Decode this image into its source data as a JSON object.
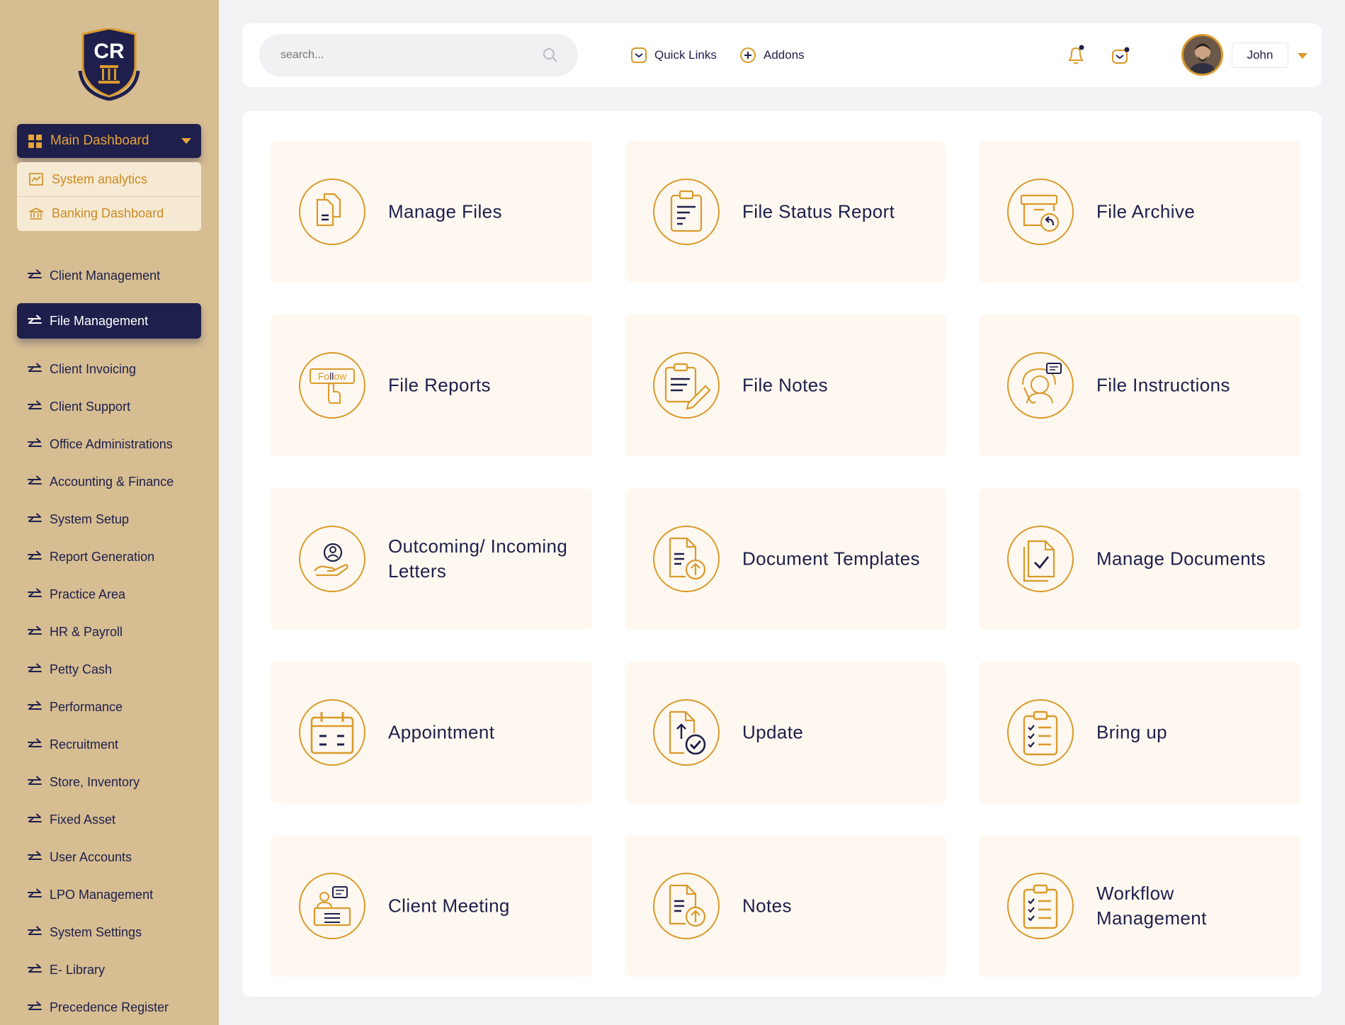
{
  "brand": {
    "logo_text": "CR"
  },
  "sidebar": {
    "dashboard_label": "Main Dashboard",
    "submenu": [
      {
        "label": "System analytics",
        "icon": "chart-icon"
      },
      {
        "label": "Banking Dashboard",
        "icon": "bank-icon"
      }
    ],
    "items": [
      {
        "label": "Client Management"
      },
      {
        "label": "File Management",
        "active": true
      },
      {
        "label": "Client Invoicing"
      },
      {
        "label": " Client Support"
      },
      {
        "label": "Office Administrations"
      },
      {
        "label": "Accounting & Finance"
      },
      {
        "label": "System Setup"
      },
      {
        "label": "Report Generation"
      },
      {
        "label": "Practice Area"
      },
      {
        "label": "HR & Payroll"
      },
      {
        "label": "Petty Cash"
      },
      {
        "label": "Performance"
      },
      {
        "label": "Recruitment"
      },
      {
        "label": "Store, Inventory"
      },
      {
        "label": "Fixed Asset"
      },
      {
        "label": "User Accounts"
      },
      {
        "label": "LPO Management"
      },
      {
        "label": "System Settings"
      },
      {
        "label": "E- Library"
      },
      {
        "label": "Precedence Register"
      }
    ]
  },
  "header": {
    "search_placeholder": "search...",
    "quick_links": "Quick Links",
    "addons": "Addons",
    "user_name": "John"
  },
  "cards": [
    {
      "label": "Manage Files",
      "icon": "files-icon"
    },
    {
      "label": "File Status Report",
      "icon": "clipboard-report-icon"
    },
    {
      "label": "File Archive",
      "icon": "archive-icon"
    },
    {
      "label": "File Reports",
      "icon": "follow-hand-icon",
      "icon_text": "Follow"
    },
    {
      "label": "File Notes",
      "icon": "notes-pencil-icon"
    },
    {
      "label": "File Instructions",
      "icon": "support-agent-icon"
    },
    {
      "label": "Outcoming/ Incoming Letters",
      "icon": "hand-person-icon"
    },
    {
      "label": "Document Templates",
      "icon": "document-upload-icon"
    },
    {
      "label": "Manage Documents",
      "icon": "document-check-icon"
    },
    {
      "label": "Appointment",
      "icon": "calendar-icon"
    },
    {
      "label": "Update",
      "icon": "file-upload-check-icon"
    },
    {
      "label": "Bring up",
      "icon": "checklist-icon"
    },
    {
      "label": "Client Meeting",
      "icon": "meeting-desk-icon"
    },
    {
      "label": "Notes",
      "icon": "document-upload-icon"
    },
    {
      "label": "Workflow Management",
      "icon": "checklist-icon"
    }
  ],
  "colors": {
    "navy": "#1e1f4b",
    "gold": "#d99a2b",
    "sidebar": "#d6bd92",
    "card": "#fff8f0"
  }
}
